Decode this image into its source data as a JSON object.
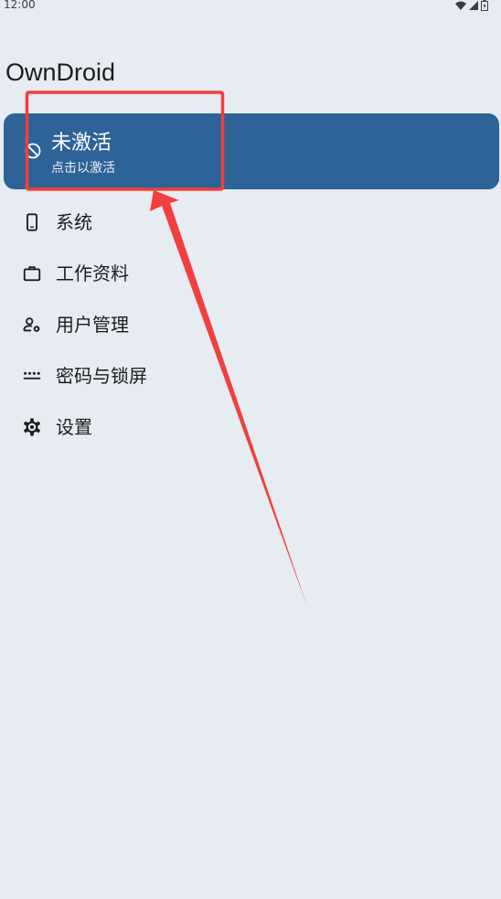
{
  "status_bar": {
    "time": "12:00",
    "icons": [
      "wifi-icon",
      "signal-icon",
      "battery-icon"
    ]
  },
  "app": {
    "title": "OwnDroid"
  },
  "status_card": {
    "title": "未激活",
    "subtitle": "点击以激活",
    "icon": "block-icon",
    "color": "#2d6397"
  },
  "menu": {
    "items": [
      {
        "label": "系统",
        "icon": "phone-icon"
      },
      {
        "label": "工作资料",
        "icon": "briefcase-icon"
      },
      {
        "label": "用户管理",
        "icon": "manage-accounts-icon"
      },
      {
        "label": "密码与锁屏",
        "icon": "password-icon"
      },
      {
        "label": "设置",
        "icon": "settings-icon"
      }
    ]
  },
  "annotation": {
    "color": "#f0403d",
    "shapes": [
      "highlight-box",
      "pointer-arrow"
    ]
  }
}
